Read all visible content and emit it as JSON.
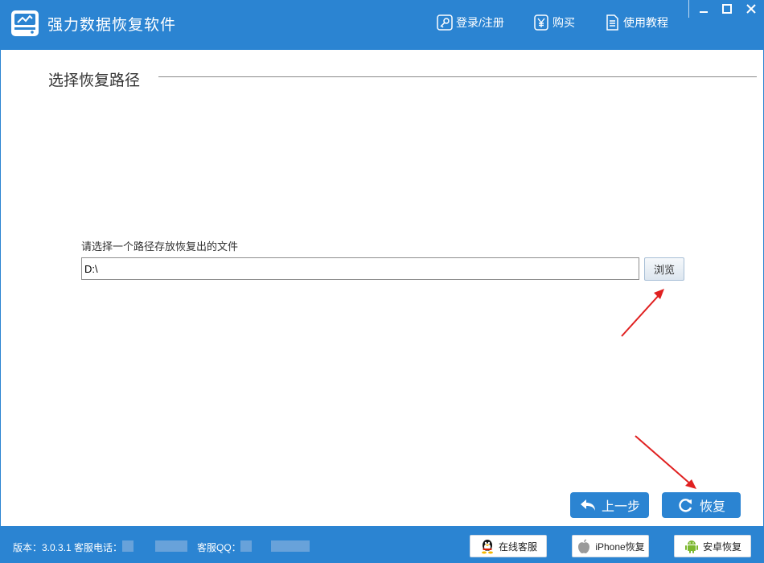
{
  "app": {
    "title": "强力数据恢复软件"
  },
  "nav": {
    "login": "登录/注册",
    "buy": "购买",
    "guide": "使用教程"
  },
  "section": {
    "title": "选择恢复路径"
  },
  "path": {
    "label": "请选择一个路径存放恢复出的文件",
    "value": "D:\\",
    "browse": "浏览"
  },
  "actions": {
    "prev": "上一步",
    "recover": "恢复"
  },
  "footer": {
    "version": "版本：3.0.3.1 客服电话：",
    "qq": "客服QQ：",
    "service": "在线客服",
    "iphone": "iPhone恢复",
    "android": "安卓恢复"
  },
  "colors": {
    "brand": "#2b84d2",
    "annotation": "#e02020"
  }
}
